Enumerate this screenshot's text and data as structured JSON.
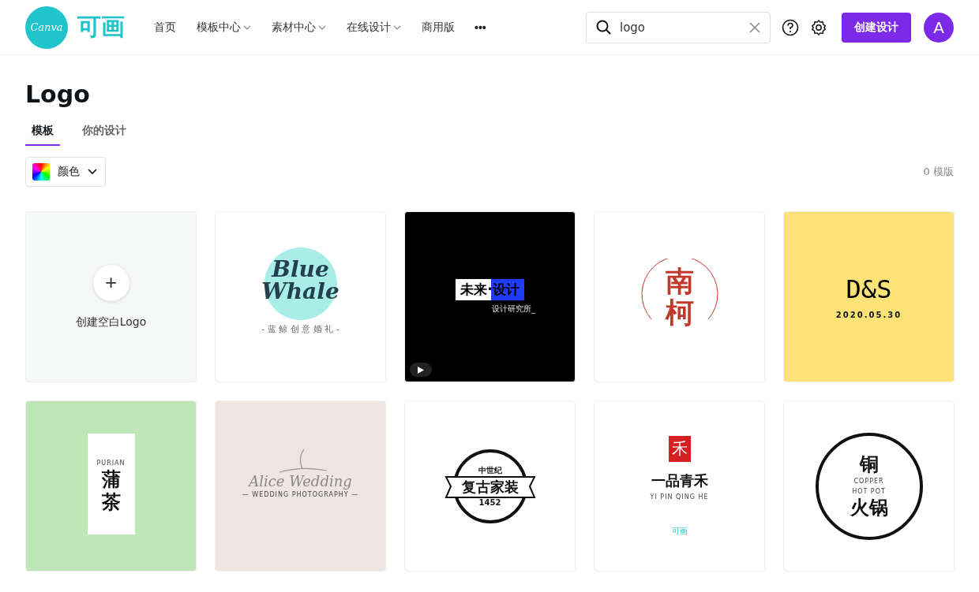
{
  "header": {
    "brand": "Canva",
    "brand_cn": "可画",
    "nav": [
      {
        "label": "首页",
        "dropdown": false
      },
      {
        "label": "模板中心",
        "dropdown": true
      },
      {
        "label": "素材中心",
        "dropdown": true
      },
      {
        "label": "在线设计",
        "dropdown": true
      },
      {
        "label": "商用版",
        "dropdown": false
      }
    ],
    "more": "•••",
    "search": {
      "value": "logo"
    },
    "create_button": "创建设计",
    "avatar": "A"
  },
  "title": "Logo",
  "tabs": [
    {
      "label": "模板",
      "selected": true
    },
    {
      "label": "你的设计",
      "selected": false
    }
  ],
  "color_filter": "颜色",
  "count": "0 模版",
  "cards": [
    {
      "kind": "blank",
      "plus": "+",
      "label": "创建空白Logo"
    },
    {
      "kind": "design",
      "video": false,
      "texts": [
        "Blue",
        "Whale",
        "- 蓝 鲸 创 意 婚 礼 -"
      ]
    },
    {
      "kind": "design",
      "video": true,
      "texts": [
        "未来·设计",
        "设计研究所_"
      ]
    },
    {
      "kind": "design",
      "video": false,
      "texts": [
        "南",
        "柯"
      ]
    },
    {
      "kind": "design",
      "video": false,
      "texts": [
        "D&S",
        "2020.05.30"
      ]
    },
    {
      "kind": "design",
      "video": false,
      "texts": [
        "PURIAN",
        "蒲",
        "茶"
      ]
    },
    {
      "kind": "design",
      "video": false,
      "texts": [
        "Alice Wedding",
        "— WEDDING PHOTOGRAPHY —"
      ]
    },
    {
      "kind": "design",
      "video": false,
      "texts": [
        "中世纪",
        "复古家装",
        "1452"
      ]
    },
    {
      "kind": "design",
      "video": false,
      "texts": [
        "禾",
        "一品青禾",
        "YI PIN QING HE",
        "可画"
      ]
    },
    {
      "kind": "design",
      "video": false,
      "texts": [
        "铜",
        "COPPER",
        "HOT POT",
        "火锅"
      ]
    }
  ]
}
